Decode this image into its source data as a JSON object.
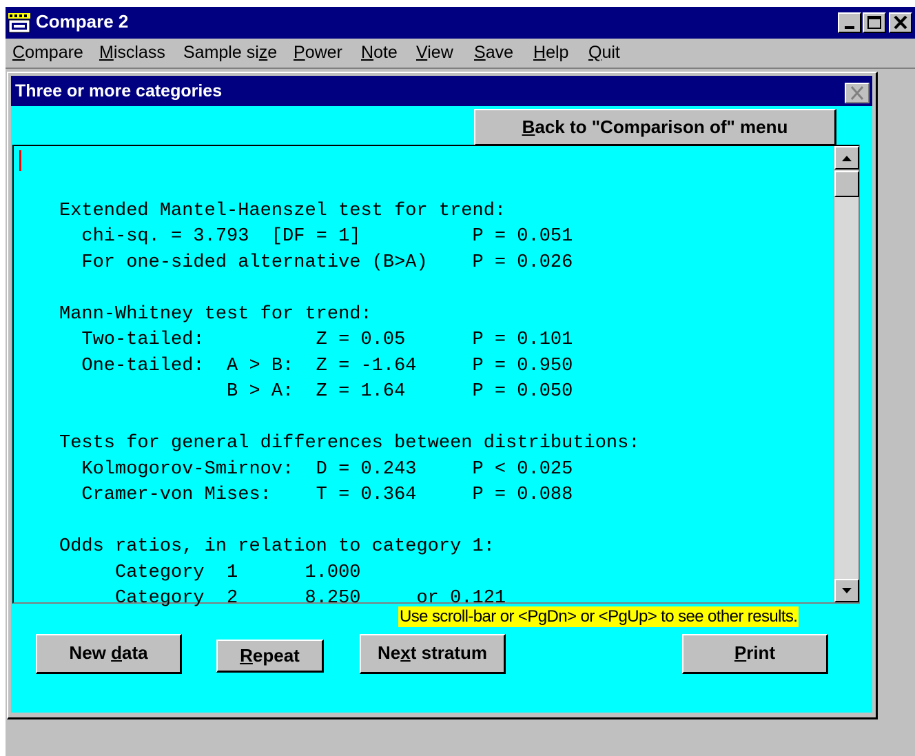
{
  "window": {
    "title": "Compare 2"
  },
  "menu": [
    {
      "label": "Compare",
      "key": "C",
      "rest": "ompare"
    },
    {
      "label": "Misclass",
      "key": "M",
      "rest": "isclass"
    },
    {
      "label": "Sample size",
      "pre": "Sample si",
      "key": "z",
      "rest": "e"
    },
    {
      "label": "Power",
      "key": "P",
      "rest": "ower"
    },
    {
      "label": "Note",
      "key": "N",
      "rest": "ote"
    },
    {
      "label": "View",
      "key": "V",
      "rest": "iew"
    },
    {
      "label": "Save",
      "key": "S",
      "rest": "ave"
    },
    {
      "label": "Help",
      "key": "H",
      "rest": "elp"
    },
    {
      "label": "Quit",
      "key": "Q",
      "rest": "uit"
    }
  ],
  "dialog": {
    "title": "Three or more categories",
    "back_button": {
      "key": "B",
      "rest": "ack to \"Comparison of\" menu"
    }
  },
  "results": {
    "lines": [
      "",
      "Extended Mantel-Haenszel test for trend:",
      "  chi-sq. = 3.793  [DF = 1]          P = 0.051",
      "  For one-sided alternative (B>A)    P = 0.026",
      "",
      "Mann-Whitney test for trend:",
      "  Two-tailed:          Z = 0.05      P = 0.101",
      "  One-tailed:  A > B:  Z = -1.64     P = 0.950",
      "               B > A:  Z = 1.64      P = 0.050",
      "",
      "Tests for general differences between distributions:",
      "  Kolmogorov-Smirnov:  D = 0.243     P < 0.025",
      "  Cramer-von Mises:    T = 0.364     P = 0.088",
      "",
      "Odds ratios, in relation to category 1:",
      "     Category  1      1.000",
      "     Category  2      8.250     or 0.121"
    ]
  },
  "hint": "Use scroll-bar or <PgDn> or <PgUp> to see other results.",
  "buttons": {
    "new_data": {
      "pre": "New ",
      "key": "d",
      "rest": "ata"
    },
    "repeat": {
      "key": "R",
      "rest": "epeat"
    },
    "next_stratum": {
      "pre": "Ne",
      "key": "x",
      "rest": "t stratum"
    },
    "print": {
      "key": "P",
      "rest": "rint"
    }
  },
  "icons": [
    "app-icon",
    "minimize-icon",
    "maximize-icon",
    "close-icon",
    "scroll-up-icon",
    "scroll-down-icon"
  ],
  "colors": {
    "titlebar": "#000080",
    "panel": "#00ffff",
    "chrome": "#c0c0c0",
    "hint_bg": "#ffff00",
    "caret": "#ff0000"
  }
}
